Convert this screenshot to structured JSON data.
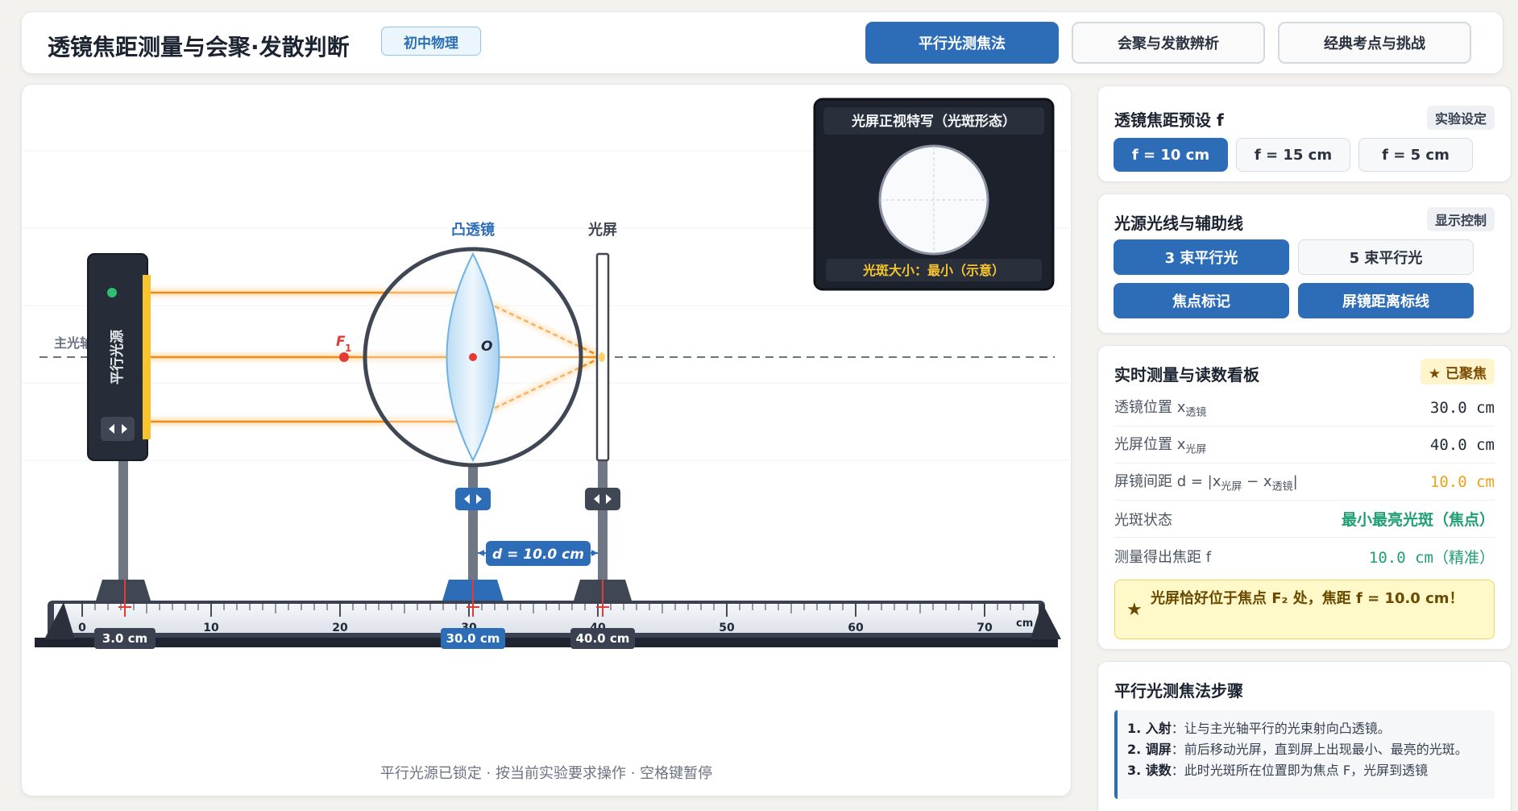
{
  "header": {
    "title": "透镜焦距测量与会聚·发散判断",
    "badge": "初中物理",
    "tabs": [
      {
        "label": "平行光测焦法",
        "active": true
      },
      {
        "label": "会聚与发散辨析",
        "active": false
      },
      {
        "label": "经典考点与挑战",
        "active": false
      }
    ]
  },
  "stage": {
    "axis_label": "主光轴",
    "light_source_label": "平行光源",
    "lens_label": "凸透镜",
    "screen_label": "光屏",
    "focus_label": "F",
    "focus_subscript": "1",
    "center_label": "O",
    "distance_label": "d = 10.0 cm",
    "ruler": {
      "ticks": [
        "0",
        "10",
        "20",
        "30",
        "40",
        "50",
        "60",
        "70"
      ],
      "unit": "cm",
      "source_pos": "3.0 cm",
      "lens_pos": "30.0 cm",
      "screen_pos": "40.0 cm",
      "source_cm": 3.0,
      "lens_cm": 30.0,
      "screen_cm": 40.0
    },
    "spot_view": {
      "title": "光屏正视特写（光斑形态）",
      "caption": "光斑大小：最小（示意）"
    },
    "hint": "平行光源已锁定 · 按当前实验要求操作 · 空格键暂停"
  },
  "panels": {
    "focal": {
      "title": "透镜焦距预设 f",
      "tag": "实验设定",
      "options": [
        {
          "label": "f = 10 cm",
          "active": true
        },
        {
          "label": "f = 15 cm",
          "active": false
        },
        {
          "label": "f = 5 cm",
          "active": false
        }
      ]
    },
    "display": {
      "title": "光源光线与辅助线",
      "tag": "显示控制",
      "buttons": [
        {
          "label": "3 束平行光",
          "active": true
        },
        {
          "label": "5 束平行光",
          "active": false
        },
        {
          "label": "焦点标记",
          "active": true
        },
        {
          "label": "屏镜距离标线",
          "active": true
        }
      ]
    },
    "readout": {
      "title": "实时测量与读数看板",
      "badge": "★ 已聚焦",
      "lens_pos_label": "透镜位置 x",
      "lens_pos_sub": "透镜",
      "lens_pos_value": "30.0 cm",
      "screen_pos_label": "光屏位置 x",
      "screen_pos_sub": "光屏",
      "screen_pos_value": "40.0 cm",
      "distance_label": "屏镜间距 d = |x",
      "distance_sub1": "光屏",
      "distance_mid": " − x",
      "distance_sub2": "透镜",
      "distance_end": "|",
      "distance_value": "10.0 cm",
      "spot_label": "光斑状态",
      "spot_value": "最小最亮光斑（焦点）",
      "focal_label": "测量得出焦距 f",
      "focal_value": "10.0 cm（精准）",
      "result": "光屏恰好位于焦点 F₂ 处，焦距 f = 10.0 cm！"
    },
    "steps": {
      "title": "平行光测焦法步骤",
      "s1_head": "1. 入射",
      "s1_text": "：让与主光轴平行的光束射向凸透镜。",
      "s2_head": "2. 调屏",
      "s2_text": "：前后移动光屏，直到屏上出现最小、最亮的光斑。",
      "s3_head": "3. 读数",
      "s3_text": "：此时光斑所在位置即为焦点 F，光屏到透镜"
    }
  }
}
